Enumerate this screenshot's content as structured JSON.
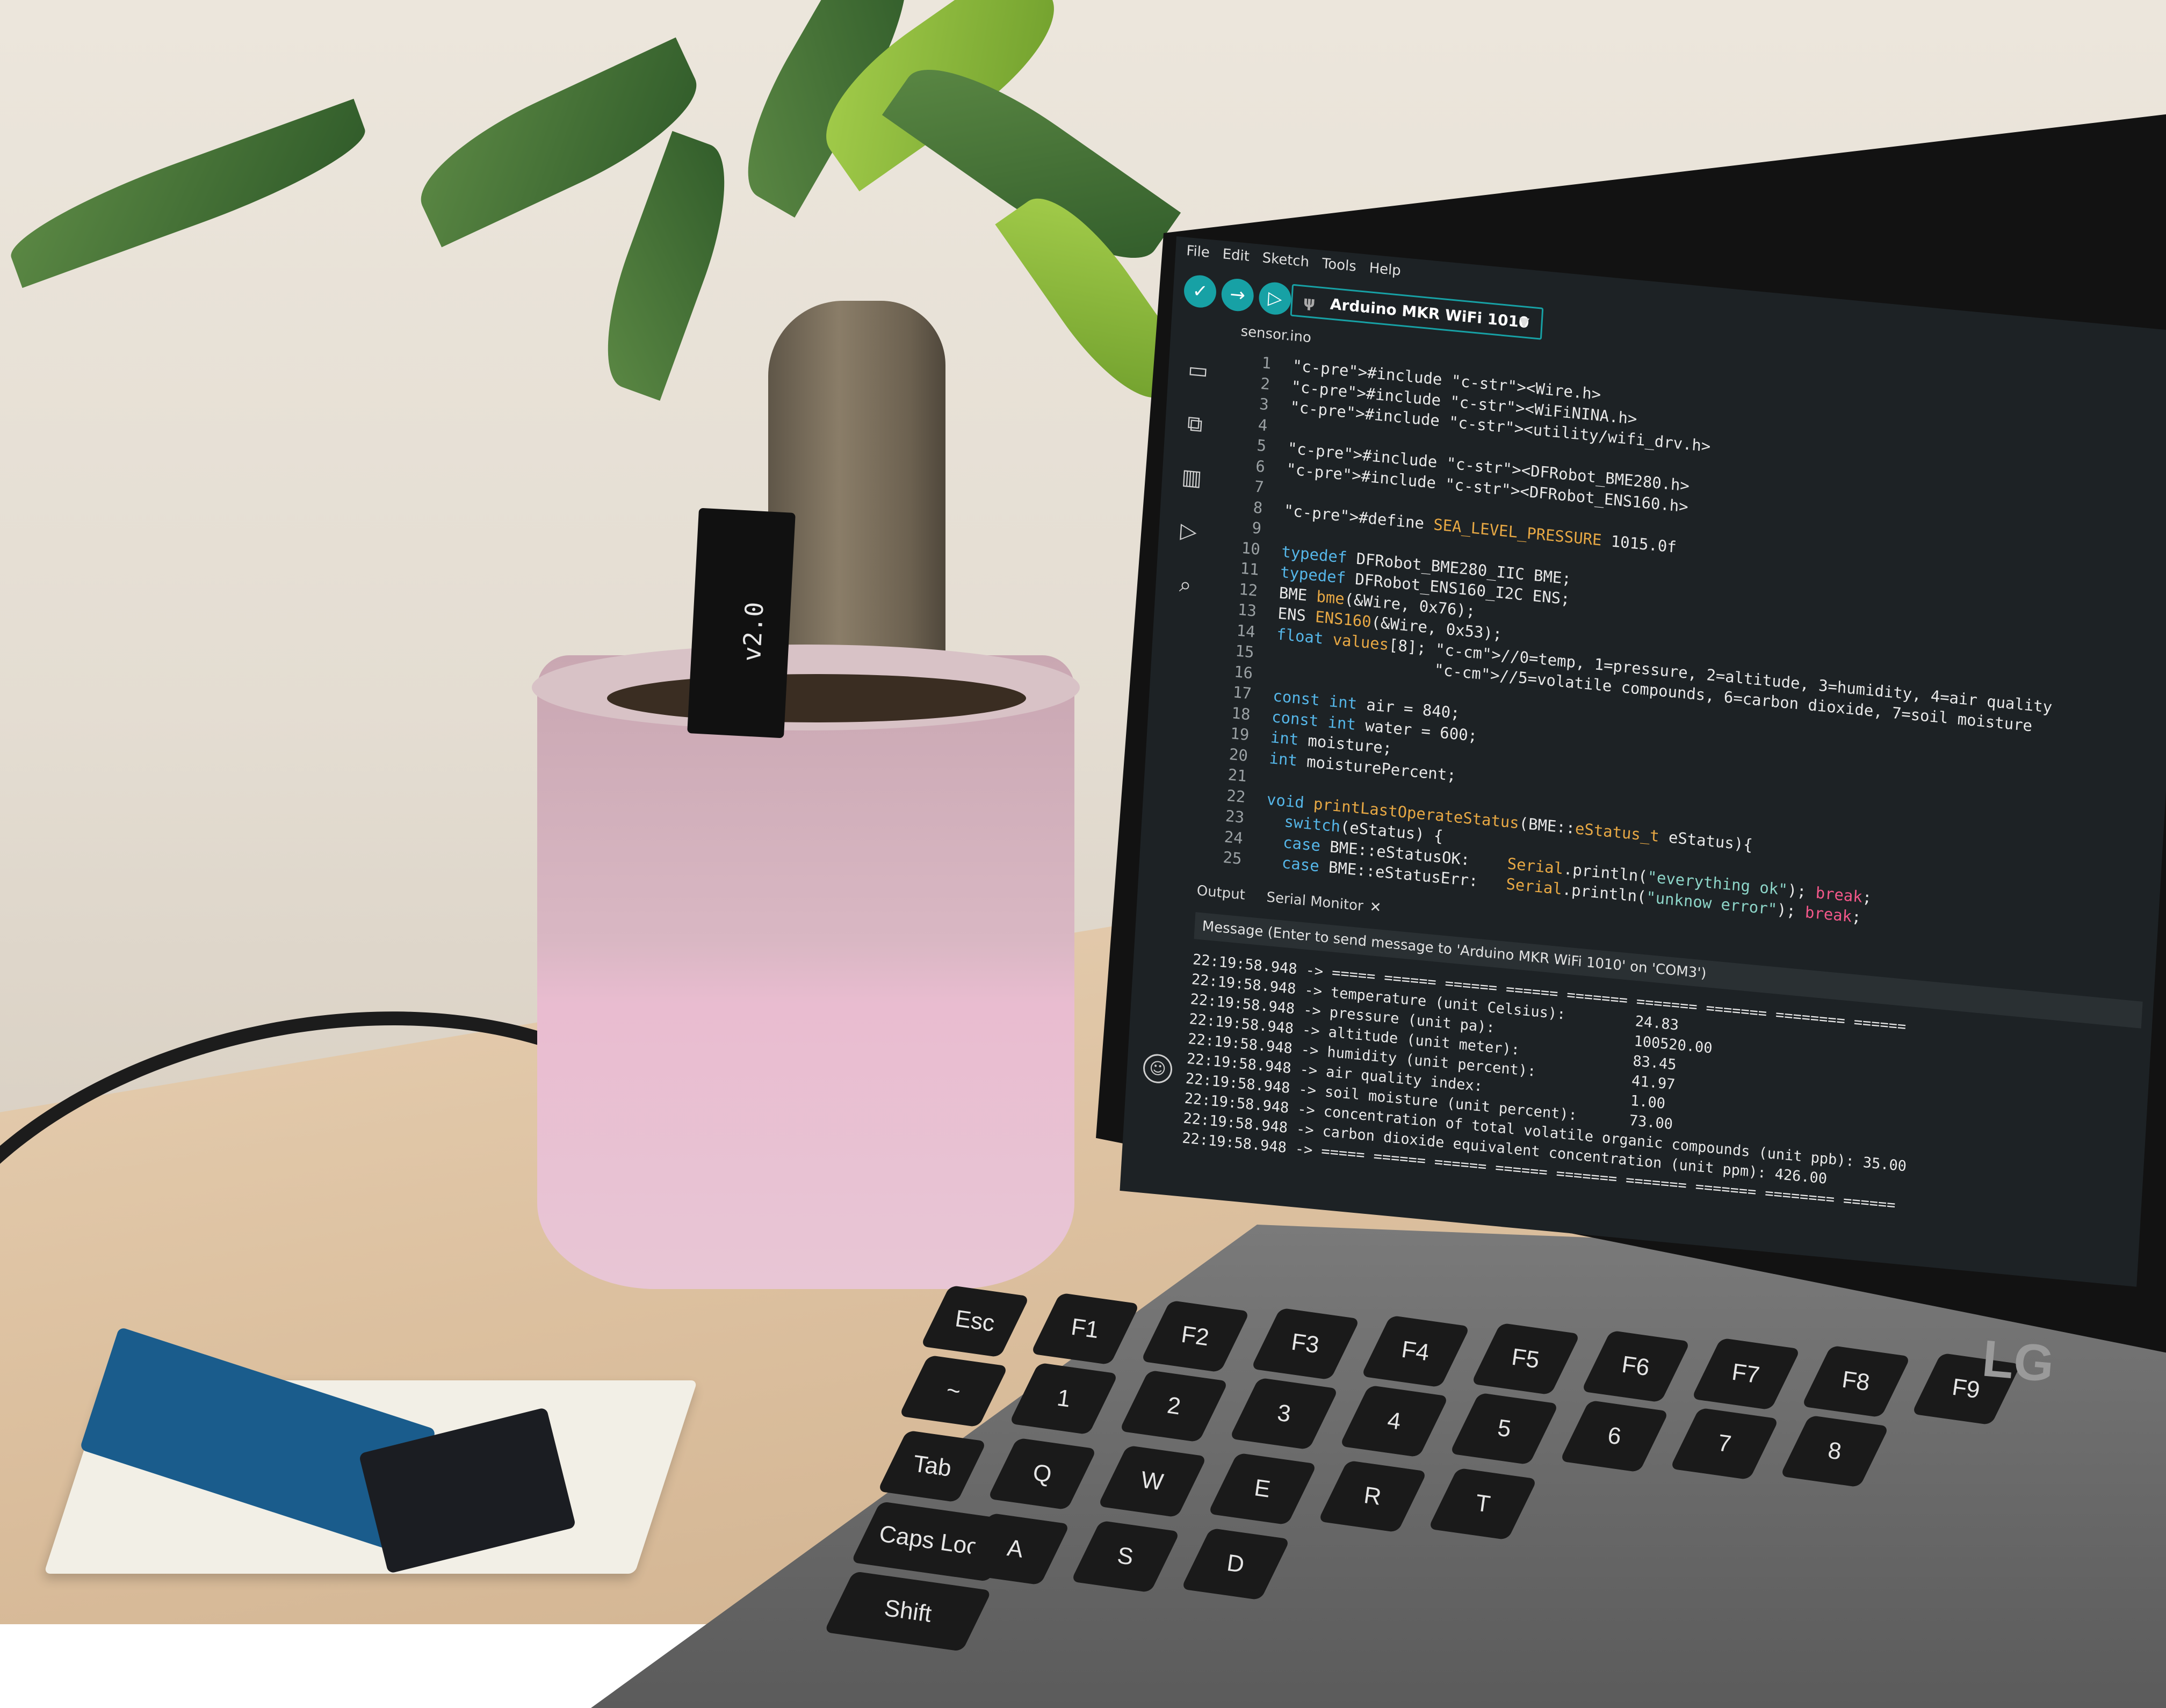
{
  "ide": {
    "menu": [
      "File",
      "Edit",
      "Sketch",
      "Tools",
      "Help"
    ],
    "toolbar": {
      "verify_icon": "check-icon",
      "upload_icon": "arrow-right-icon",
      "debug_icon": "debug-icon"
    },
    "board": "Arduino MKR WiFi 1010",
    "tab_name": "sensor.ino",
    "sidebar_icons": [
      "folder-icon",
      "board-icon",
      "library-icon",
      "debug-icon",
      "search-icon"
    ],
    "code": [
      {
        "n": "1",
        "t": "#include <Wire.h>"
      },
      {
        "n": "2",
        "t": "#include <WiFiNINA.h>"
      },
      {
        "n": "3",
        "t": "#include <utility/wifi_drv.h>"
      },
      {
        "n": "4",
        "t": ""
      },
      {
        "n": "5",
        "t": "#include <DFRobot_BME280.h>"
      },
      {
        "n": "6",
        "t": "#include <DFRobot_ENS160.h>"
      },
      {
        "n": "7",
        "t": ""
      },
      {
        "n": "8",
        "t": "#define SEA_LEVEL_PRESSURE 1015.0f"
      },
      {
        "n": "9",
        "t": ""
      },
      {
        "n": "10",
        "t": "typedef DFRobot_BME280_IIC BME;"
      },
      {
        "n": "11",
        "t": "typedef DFRobot_ENS160_I2C ENS;"
      },
      {
        "n": "12",
        "t": "BME bme(&Wire, 0x76);"
      },
      {
        "n": "13",
        "t": "ENS ENS160(&Wire, 0x53);"
      },
      {
        "n": "14",
        "t": "float values[8]; //0=temp, 1=pressure, 2=altitude, 3=humidity, 4=air quality"
      },
      {
        "n": "15",
        "t": "                 //5=volatile compounds, 6=carbon dioxide, 7=soil moisture"
      },
      {
        "n": "16",
        "t": ""
      },
      {
        "n": "17",
        "t": "const int air = 840;"
      },
      {
        "n": "18",
        "t": "const int water = 600;"
      },
      {
        "n": "19",
        "t": "int moisture;"
      },
      {
        "n": "20",
        "t": "int moisturePercent;"
      },
      {
        "n": "21",
        "t": ""
      },
      {
        "n": "22",
        "t": "void printLastOperateStatus(BME::eStatus_t eStatus){"
      },
      {
        "n": "23",
        "t": "  switch(eStatus) {"
      },
      {
        "n": "24",
        "t": "  case BME::eStatusOK:    Serial.println(\"everything ok\"); break;"
      },
      {
        "n": "25",
        "t": "  case BME::eStatusErr:   Serial.println(\"unknow error\"); break;"
      }
    ],
    "panel_tabs": {
      "output": "Output",
      "serial_monitor": "Serial Monitor"
    },
    "message_placeholder": "Message (Enter to send message to 'Arduino MKR WiFi 1010' on 'COM3')",
    "serial_lines": [
      "22:19:58.948 -> ===== ====== ====== ====== ======= ======= ======= ======== ======",
      "22:19:58.948 -> temperature (unit Celsius):        24.83",
      "22:19:58.948 -> pressure (unit pa):                100520.00",
      "22:19:58.948 -> altitude (unit meter):             83.45",
      "22:19:58.948 -> humidity (unit percent):           41.97",
      "22:19:58.948 -> air quality index:                 1.00",
      "22:19:58.948 -> soil moisture (unit percent):      73.00",
      "22:19:58.948 -> concentration of total volatile organic compounds (unit ppb): 35.00",
      "22:19:58.948 -> carbon dioxide equivalent concentration (unit ppm): 426.00",
      "22:19:58.948 -> ===== ====== ====== ====== ======= ======= ======= ======== ======"
    ]
  },
  "hardware": {
    "sensor_label": "v2.0",
    "laptop_logo": "LG"
  },
  "keyboard": {
    "keys": [
      "Esc",
      "F1",
      "F2",
      "F3",
      "F4",
      "F5",
      "F6",
      "F7",
      "F8",
      "F9",
      "~",
      "1",
      "2",
      "3",
      "4",
      "5",
      "6",
      "7",
      "8",
      "Tab",
      "Q",
      "W",
      "E",
      "R",
      "T",
      "Caps Lock",
      "A",
      "S",
      "D",
      "Shift"
    ]
  },
  "colors": {
    "accent": "#17a1a5",
    "screen_bg": "#1d2225",
    "pot": "#e0bfcd"
  }
}
